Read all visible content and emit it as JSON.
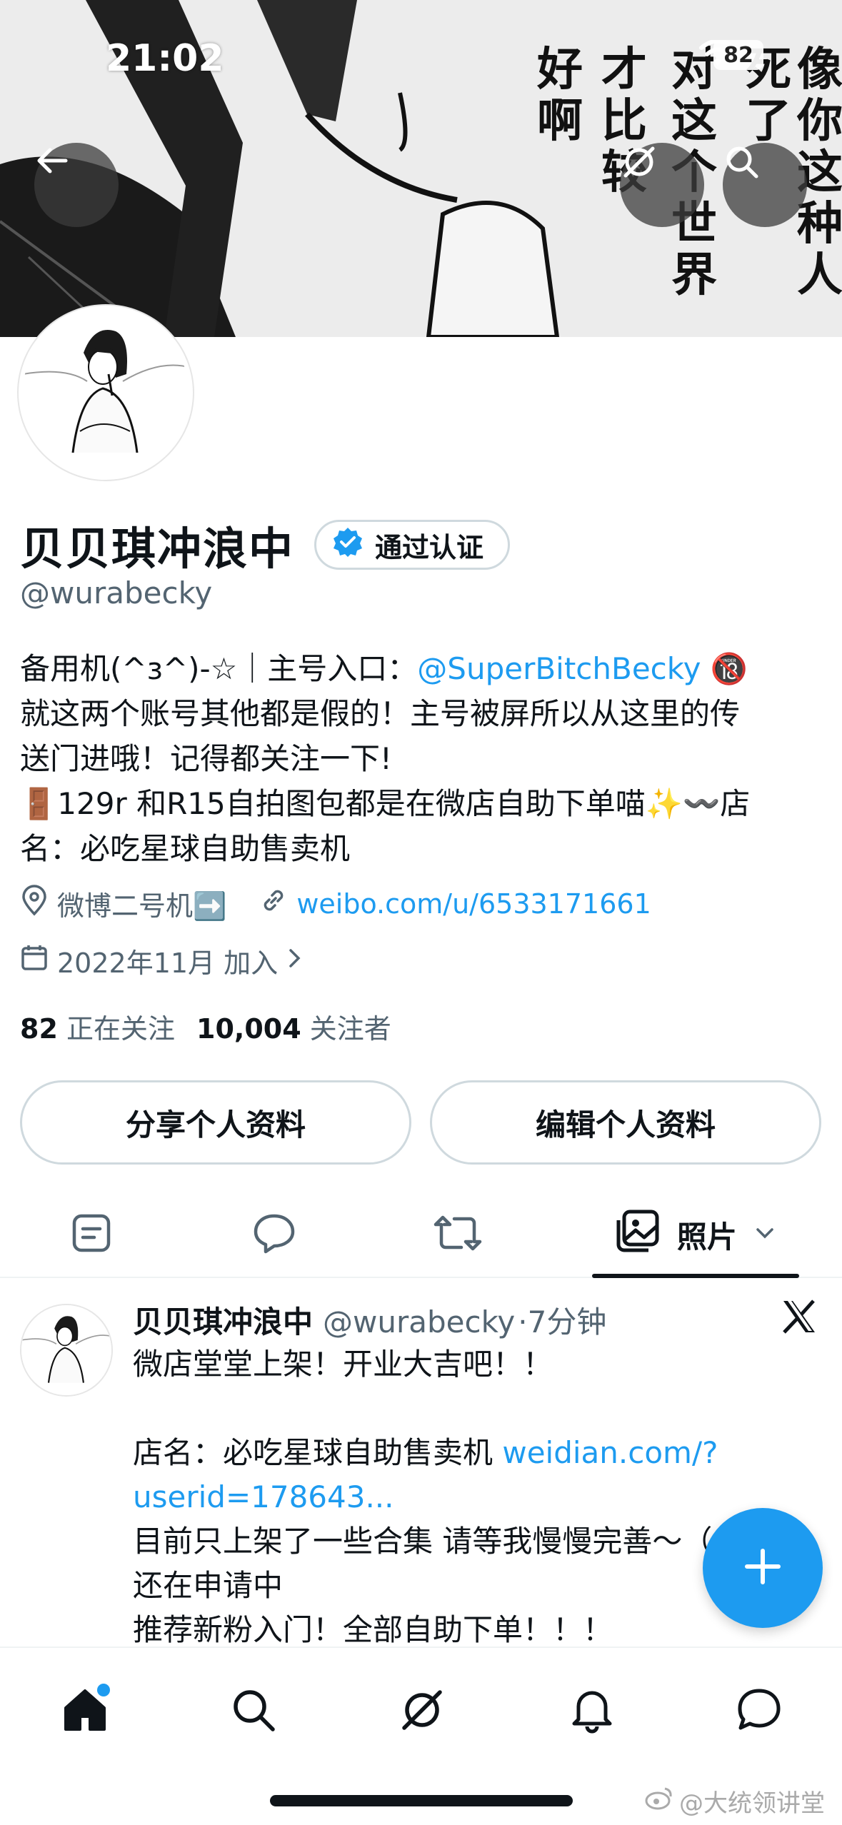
{
  "status_bar": {
    "time": "21:02",
    "battery": "82"
  },
  "banner": {
    "manga_text_columns": [
      "像你这种人",
      "死了",
      "对这个世界",
      "才比较",
      "好啊"
    ]
  },
  "profile": {
    "display_name": "贝贝琪冲浪中",
    "verified_label": "通过认证",
    "handle": "@wurabecky",
    "bio": {
      "line1_prefix": "备用机(^з^)-☆｜主号入口：",
      "line1_mention": "@SuperBitchBecky",
      "line1_emoji": "🔞",
      "line2": "就这两个账号其他都是假的！主号被屏所以从这里的传",
      "line3": "送门进哦！记得都关注一下!",
      "line4": "🚪129r 和R15自拍图包都是在微店自助下单喵✨〰️店",
      "line5": "名：必吃星球自助售卖机"
    },
    "location": "微博二号机➡️",
    "website": "weibo.com/u/6533171661",
    "joined": "2022年11月 加入",
    "following_count": "82",
    "following_label": "正在关注",
    "followers_count": "10,004",
    "followers_label": "关注者"
  },
  "buttons": {
    "share": "分享个人资料",
    "edit": "编辑个人资料"
  },
  "tabs": {
    "active_label": "照片"
  },
  "tweet": {
    "name": "贝贝琪冲浪中",
    "handle": "@wurabecky",
    "time": "·7分钟",
    "lines": {
      "l1": "微店堂堂上架！开业大吉吧！！",
      "l2_prefix": "店名：必吃星球自助售卖机 ",
      "l2_link": "weidian.com/?",
      "l3_link": "userid=178643...",
      "l4": "目前只上架了一些合集 请等我慢慢完善～（",
      "l5": "还在申请中",
      "l6": "推荐新粉入门！全部自助下单！！！"
    }
  },
  "watermark": "@大统领讲堂",
  "colors": {
    "accent": "#1d9bf0",
    "text": "#0f1419",
    "muted": "#536471"
  }
}
